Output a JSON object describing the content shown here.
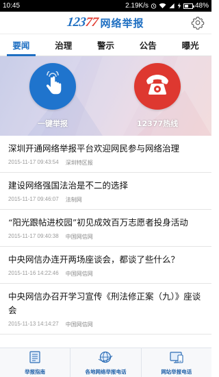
{
  "status_bar": {
    "time": "10:45",
    "speed": "2.19K/s",
    "battery_percent": "48%",
    "battery_level": 0.48
  },
  "header": {
    "logo_number_part1": "123",
    "logo_number_part2": "77",
    "logo_text": "网络举报",
    "logo_colors": {
      "blue": "#1e6fc2",
      "red": "#e03a2f"
    },
    "settings_icon": "gear-icon"
  },
  "tabs": [
    {
      "label": "要闻",
      "active": true
    },
    {
      "label": "治理",
      "active": false
    },
    {
      "label": "警示",
      "active": false
    },
    {
      "label": "公告",
      "active": false
    },
    {
      "label": "曝光",
      "active": false
    }
  ],
  "banner": {
    "report_label": "一键举报",
    "report_icon": "hand-pointer-icon",
    "hotline_label": "12377热线",
    "hotline_icon": "telephone-icon",
    "colors": {
      "blue": "#1f74cd",
      "red": "#de3830"
    }
  },
  "news": [
    {
      "title": "深圳开通网络举报平台欢迎网民参与网络治理",
      "time": "2015-11-17 09:43:54",
      "source": "深圳特区报"
    },
    {
      "title": "建设网络强国法治是不二的选择",
      "time": "2015-11-17 09:46:07",
      "source": "法制网"
    },
    {
      "title": "“阳光跟帖进校园”初见成效百万志愿者投身活动",
      "time": "2015-11-17 09:40:38",
      "source": "中国网信网"
    },
    {
      "title": "中央网信办连开两场座谈会，都谈了些什么？",
      "time": "2015-11-16 14:22:46",
      "source": "中国网信网"
    },
    {
      "title": "中央网信办召开学习宣传《刑法修正案（九）》座谈会",
      "time": "2015-11-13 14:14:27",
      "source": "中国网信网"
    }
  ],
  "bottom_nav": [
    {
      "label": "举报指南",
      "icon": "guide-book-icon"
    },
    {
      "label": "各地网络举报电话",
      "icon": "globe-icon"
    },
    {
      "label": "网站举报电话",
      "icon": "website-phone-icon"
    }
  ]
}
